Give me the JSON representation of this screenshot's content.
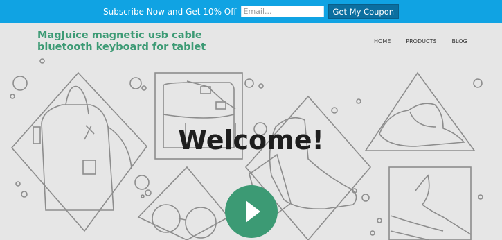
{
  "subscribe": {
    "promo_text": "Subscribe Now and Get 10% Off",
    "email_placeholder": "Email...",
    "button_label": "Get My Coupon"
  },
  "header": {
    "brand_line1": "MagJuice magnetic usb cable",
    "brand_line2": "bluetooth keyboard for tablet",
    "nav": [
      {
        "label": "HOME",
        "active": true
      },
      {
        "label": "PRODUCTS",
        "active": false
      },
      {
        "label": "BLOG",
        "active": false
      }
    ]
  },
  "hero": {
    "heading": "Welcome!",
    "play_icon": "play-icon"
  },
  "colors": {
    "topbar": "#10a3e3",
    "brand": "#3c9a74",
    "play_button": "#3c9a74",
    "background": "#e6e6e6"
  }
}
